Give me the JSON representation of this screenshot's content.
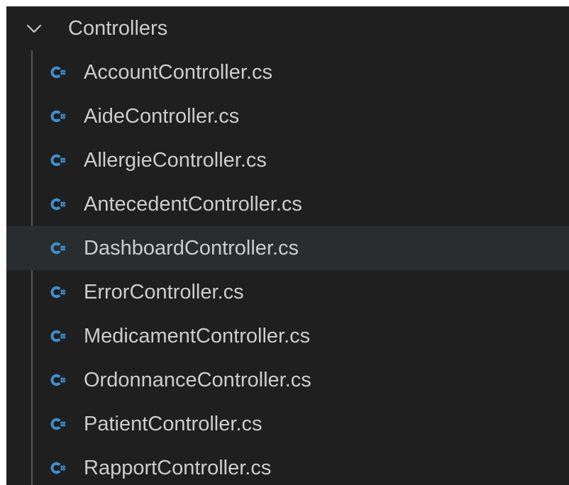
{
  "folder": {
    "name": "Controllers",
    "expanded": true
  },
  "files": [
    {
      "name": "AccountController.cs"
    },
    {
      "name": "AideController.cs"
    },
    {
      "name": "AllergieController.cs"
    },
    {
      "name": "AntecedentController.cs"
    },
    {
      "name": "DashboardController.cs"
    },
    {
      "name": "ErrorController.cs"
    },
    {
      "name": "MedicamentController.cs"
    },
    {
      "name": "OrdonnanceController.cs"
    },
    {
      "name": "PatientController.cs"
    },
    {
      "name": "RapportController.cs"
    }
  ],
  "highlighted_file": "DashboardController.cs",
  "icons": {
    "folder_toggle": "chevron-down-icon",
    "file": "csharp-file-icon"
  },
  "colors": {
    "background": "#1f1f1f",
    "text": "#cccccc",
    "hover_row": "#2a2d2e",
    "icon": "#3f8fd2",
    "indent_guide": "#585858"
  }
}
